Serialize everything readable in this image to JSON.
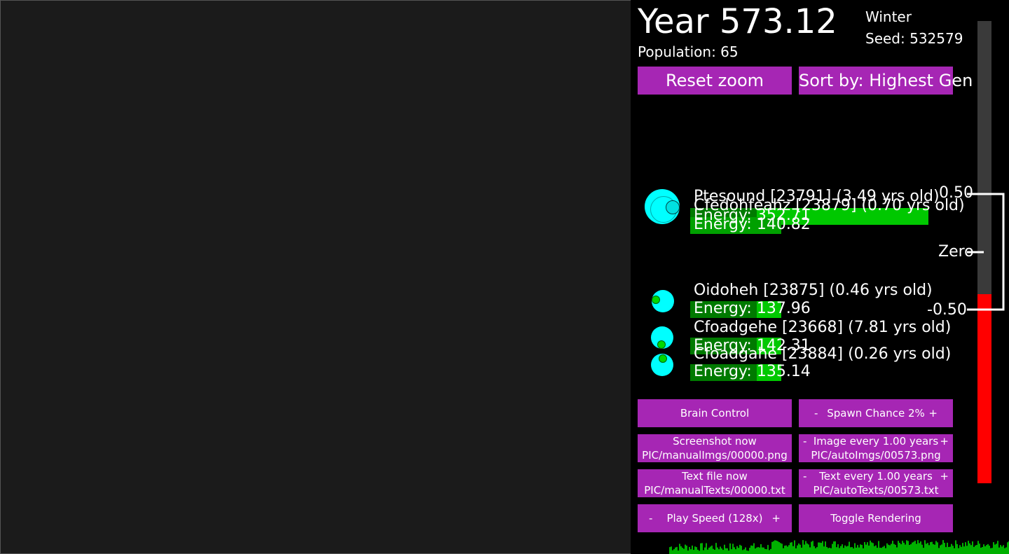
{
  "hud": {
    "year": "Year 573.12",
    "population": "Population: 65",
    "season": "Winter",
    "seed": "Seed: 532579"
  },
  "buttons": {
    "reset_zoom": "Reset zoom",
    "sort_by": "Sort by: Highest Gen",
    "brain_control": "Brain Control",
    "spawn_chance": "Spawn Chance 2%",
    "screenshot_now": "Screenshot now",
    "screenshot_path": "PIC/manualImgs/00000.png",
    "image_every": "Image every 1.00 years",
    "image_path": "PIC/autoImgs/00573.png",
    "text_file_now": "Text file now",
    "text_file_path": "PIC/manualTexts/00000.txt",
    "text_every": "Text every 1.00 years",
    "text_path": "PIC/autoTexts/00573.txt",
    "play_speed": "Play Speed (128x)",
    "toggle_rendering": "Toggle Rendering",
    "minus": "-",
    "plus": "+"
  },
  "creatures": [
    {
      "name": "Ptesound [23791] (3.49 yrs old)",
      "energy": "Energy: 352.71",
      "energy_fraction": 0.85
    },
    {
      "name": "Cfedohfeahz [23879] (0.70 yrs old)",
      "energy": "Energy: 140.82",
      "energy_fraction": 0.35
    },
    {
      "name": "Oidoheh [23875] (0.46 yrs old)",
      "energy": "Energy: 137.96",
      "energy_fraction": 0.34
    },
    {
      "name": "Cfoadgehe [23668] (7.81 yrs old)",
      "energy": "Energy: 142.31",
      "energy_fraction": 0.36
    },
    {
      "name": "Cfoadgahe [23884] (0.26 yrs old)",
      "energy": "Energy: 135.14",
      "energy_fraction": 0.33
    }
  ],
  "meter": {
    "top_label": "0.50",
    "zero_label": "Zero",
    "bottom_label": "-0.50",
    "value_fraction": 0.41
  },
  "colors": {
    "button": "#a626b4",
    "creature": "#00ffff",
    "energy_bar": "#00c800",
    "meter_fill": "#ff0000",
    "histogram": "#00b000"
  }
}
